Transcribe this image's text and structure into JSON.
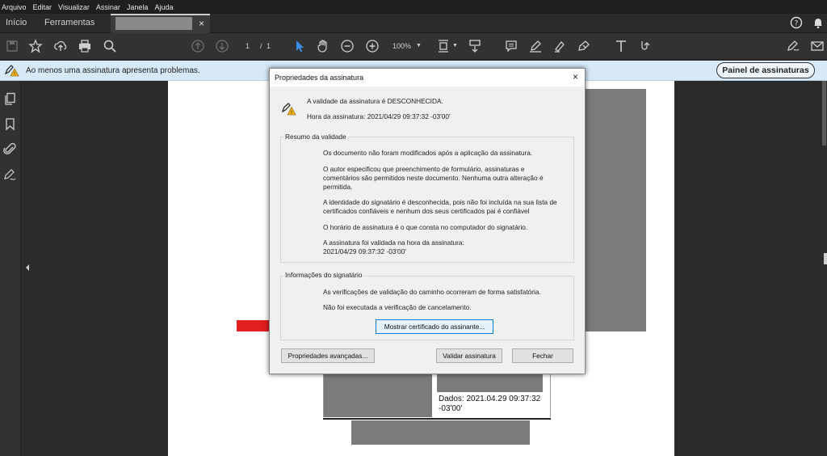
{
  "menu": [
    "Arquivo",
    "Editar",
    "Visualizar",
    "Assinar",
    "Janela",
    "Ajuda"
  ],
  "tabs": {
    "home": "Início",
    "tools": "Ferramentas",
    "doc_close": "×"
  },
  "toolbar": {
    "page_current": "1",
    "page_sep": "/",
    "page_total": "1",
    "zoom": "100%"
  },
  "notification": {
    "message": "Ao menos uma assinatura apresenta problemas.",
    "panel_button": "Painel de assinaturas"
  },
  "dialog": {
    "title": "Propriedades da assinatura",
    "close": "×",
    "validity_status": "A validade da assinatura é DESCONHECIDA.",
    "signing_time": "Hora da assinatura:  2021/04/29 09:37:32 -03'00'",
    "summary_group": "Resumo da validade",
    "summary_lines": [
      "Os documento não foram modificados após a aplicação da assinatura.",
      "O autor especificou que preenchimento de formulário, assinaturas e\ncomentários são permitidos neste documento. Nenhuma outra alteração é\npermitida.",
      "A identidade do signatário é desconhecida, pois não foi incluída na sua lista de\ncertificados confiáveis e nenhum dos seus certificados pai é confiável",
      "O horário de assinatura é o que consta no computador do signatário.",
      "A assinatura foi validada na hora da assinatura:\n2021/04/29 09:37:32 -03'00'"
    ],
    "signer_group": "Informações do signatário",
    "signer_lines": [
      "As verificações de validação do caminho ocorreram de forma satisfatória.",
      "Não foi executada a verificação de cancelamento."
    ],
    "show_cert_button": "Mostrar certificado do assinante...",
    "advanced_button": "Propriedades avançadas...",
    "validate_button": "Validar assinatura",
    "close_button": "Fechar"
  },
  "document": {
    "signature_text": "Dados: 2021.04.29 09:37:32\n-03'00'"
  },
  "colors": {
    "notification_bg": "#d7e9f7",
    "select_tool": "#3b8ee8",
    "arrow": "#e11f1f"
  }
}
